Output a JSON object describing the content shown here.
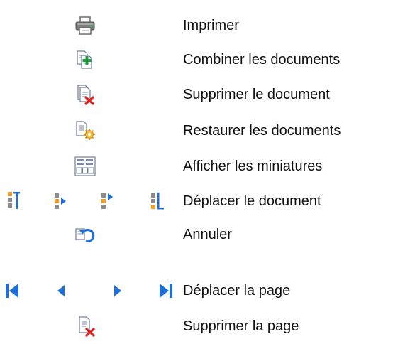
{
  "rows": [
    {
      "label": "Imprimer",
      "icons": [
        "printer-icon"
      ]
    },
    {
      "label": "Combiner les documents",
      "icons": [
        "combine-documents-icon"
      ]
    },
    {
      "label": "Supprimer le document",
      "icons": [
        "delete-document-icon"
      ]
    },
    {
      "label": "Restaurer les documents",
      "icons": [
        "restore-documents-icon"
      ]
    },
    {
      "label": "Afficher les miniatures",
      "icons": [
        "show-thumbnails-icon"
      ]
    },
    {
      "label": "Déplacer le document",
      "icons": [
        "move-document-to-top-icon",
        "move-document-up-icon",
        "move-document-down-icon",
        "move-document-to-bottom-icon"
      ]
    },
    {
      "label": "Annuler",
      "icons": [
        "undo-icon"
      ]
    },
    {
      "label": "Déplacer la page",
      "icons": [
        "first-page-icon",
        "previous-page-icon",
        "next-page-icon",
        "last-page-icon"
      ]
    },
    {
      "label": "Supprimer la page",
      "icons": [
        "delete-page-icon"
      ]
    }
  ],
  "colors": {
    "text": "#111111",
    "blue": "#1e6fd9",
    "red": "#e0201c",
    "green": "#1f9b3a",
    "orange": "#f09a2a",
    "gray": "#8c8c8c"
  }
}
